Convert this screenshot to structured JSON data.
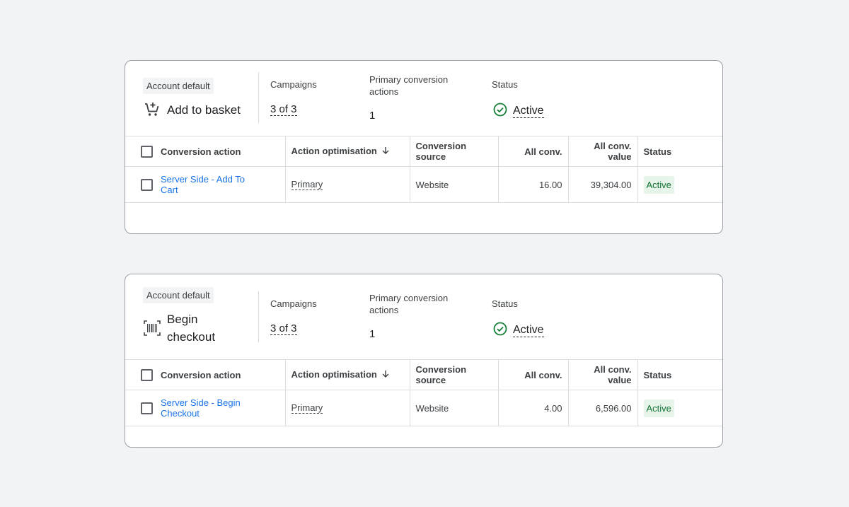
{
  "cards": [
    {
      "chip": "Account default",
      "goal_name": "Add to basket",
      "goal_icon": "add-to-cart-icon",
      "metrics": {
        "campaigns_label": "Campaigns",
        "campaigns_value": "3 of 3",
        "primary_label": "Primary conversion actions",
        "primary_value": "1",
        "status_label": "Status",
        "status_value": "Active"
      },
      "columns": [
        "Conversion action",
        "Action optimisation",
        "Conversion source",
        "All conv.",
        "All conv. value",
        "Status"
      ],
      "rows": [
        {
          "action": "Server Side - Add To Cart",
          "optimisation": "Primary",
          "source": "Website",
          "all_conv": "16.00",
          "all_conv_value": "39,304.00",
          "status": "Active"
        }
      ]
    },
    {
      "chip": "Account default",
      "goal_name": "Begin checkout",
      "goal_icon": "barcode-scan-icon",
      "metrics": {
        "campaigns_label": "Campaigns",
        "campaigns_value": "3 of 3",
        "primary_label": "Primary conversion actions",
        "primary_value": "1",
        "status_label": "Status",
        "status_value": "Active"
      },
      "columns": [
        "Conversion action",
        "Action optimisation",
        "Conversion source",
        "All conv.",
        "All conv. value",
        "Status"
      ],
      "rows": [
        {
          "action": "Server Side - Begin Checkout",
          "optimisation": "Primary",
          "source": "Website",
          "all_conv": "4.00",
          "all_conv_value": "6,596.00",
          "status": "Active"
        }
      ]
    }
  ],
  "colors": {
    "link": "#1a73e8",
    "active_green": "#188038",
    "badge_bg": "#e6f4ea"
  }
}
